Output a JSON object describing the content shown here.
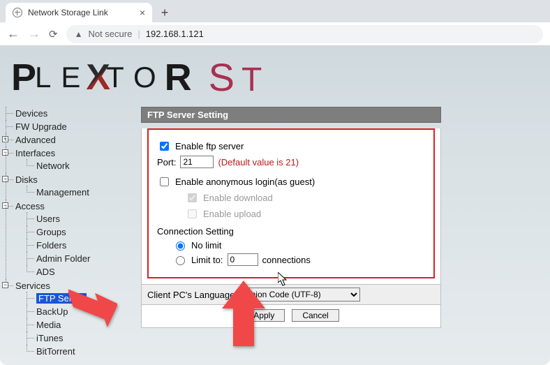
{
  "browser": {
    "tab_title": "Network Storage Link",
    "security_label": "Not secure",
    "url": "192.168.1.121"
  },
  "logo": {
    "text_a": "PLE",
    "text_x": "X",
    "text_b": "TOR",
    "text_st": "ST"
  },
  "sidebar": {
    "devices": "Devices",
    "fw_upgrade": "FW Upgrade",
    "advanced": "Advanced",
    "interfaces": "Interfaces",
    "network": "Network",
    "disks": "Disks",
    "management": "Management",
    "access": "Access",
    "users": "Users",
    "groups": "Groups",
    "folders": "Folders",
    "admin_folder": "Admin Folder",
    "ads": "ADS",
    "services": "Services",
    "ftp_server": "FTP Server",
    "backup": "BackUp",
    "media": "Media",
    "itunes": "iTunes",
    "bittorrent": "BitTorrent"
  },
  "panel": {
    "title": "FTP Server Setting",
    "enable_ftp": "Enable ftp server",
    "port_label": "Port:",
    "port_value": "21",
    "port_hint": "(Default value is 21)",
    "anon_login": "Enable anonymous login(as guest)",
    "enable_download": "Enable download",
    "enable_upload": "Enable upload",
    "conn_setting": "Connection Setting",
    "no_limit": "No limit",
    "limit_to": "Limit to:",
    "limit_value": "0",
    "connections": "connections",
    "lang_label": "Client PC's Language:",
    "lang_value": "Union Code (UTF-8)",
    "apply": "Apply",
    "cancel": "Cancel"
  }
}
